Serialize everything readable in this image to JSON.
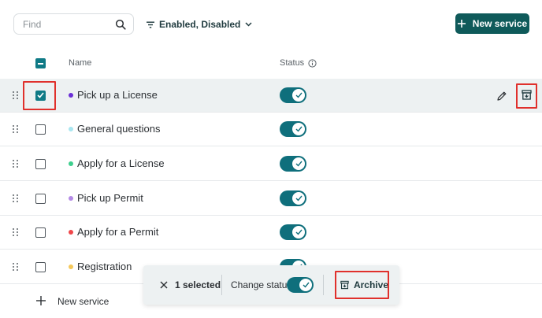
{
  "search": {
    "placeholder": "Find",
    "icon": "search-icon"
  },
  "filter": {
    "label": "Enabled, Disabled"
  },
  "toolbar": {
    "new_service_label": "New service"
  },
  "table": {
    "columns": {
      "name": "Name",
      "status": "Status"
    },
    "rows": [
      {
        "name": "Pick up a License",
        "dot_color": "#6b2fd6",
        "checked": true,
        "enabled": true
      },
      {
        "name": "General questions",
        "dot_color": "#a8e6f0",
        "checked": false,
        "enabled": true
      },
      {
        "name": "Apply for a License",
        "dot_color": "#3ecf8e",
        "checked": false,
        "enabled": true
      },
      {
        "name": "Pick up Permit",
        "dot_color": "#b48ae6",
        "checked": false,
        "enabled": true
      },
      {
        "name": "Apply for a Permit",
        "dot_color": "#f0474a",
        "checked": false,
        "enabled": true
      },
      {
        "name": "Registration",
        "dot_color": "#f5c85a",
        "checked": false,
        "enabled": true
      }
    ]
  },
  "add_row": {
    "label": "New service"
  },
  "action_bar": {
    "selected_label": "1 selected",
    "change_status_label": "Change status",
    "archive_label": "Archive"
  },
  "colors": {
    "accent": "#0f6f7c",
    "primary_button": "#0f5a5a",
    "highlight": "#e0302c"
  }
}
